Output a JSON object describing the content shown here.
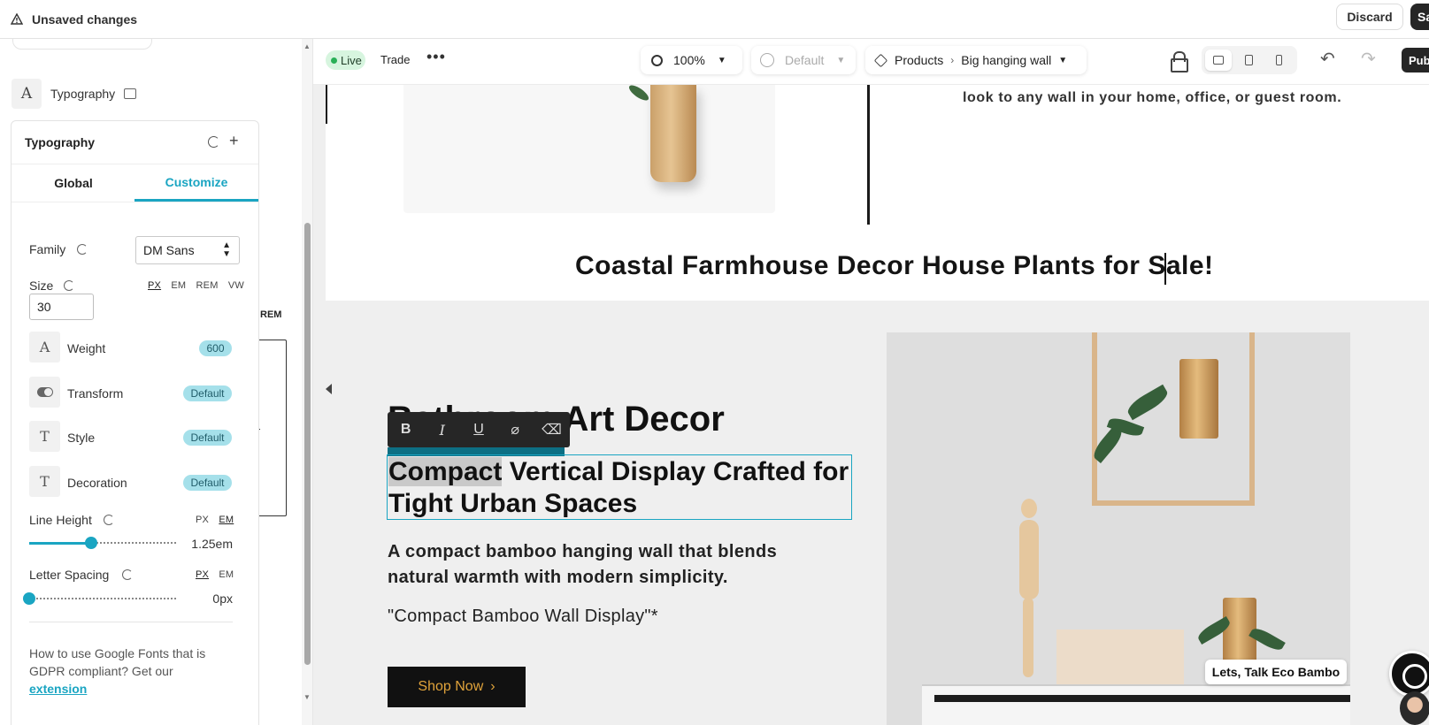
{
  "topbar": {
    "warning_icon": "alert-triangle-icon",
    "status_text": "Unsaved changes",
    "discard_label": "Discard",
    "save_label": "Sa"
  },
  "sidebar": {
    "section_icon": "letter-a-icon",
    "section_label": "Typography",
    "device_icon": "desktop-icon",
    "stray_unit": "REM",
    "panel": {
      "title": "Typography",
      "tabs": [
        {
          "label": "Global",
          "active": false
        },
        {
          "label": "Customize",
          "active": true
        }
      ],
      "family": {
        "label": "Family",
        "value": "DM Sans"
      },
      "size": {
        "label": "Size",
        "value": "30",
        "units": [
          "PX",
          "EM",
          "REM",
          "VW"
        ],
        "active_unit": "PX"
      },
      "weight": {
        "label": "Weight",
        "value": "600",
        "icon": "A"
      },
      "transform": {
        "label": "Transform",
        "value": "Default"
      },
      "style": {
        "label": "Style",
        "value": "Default",
        "icon": "T"
      },
      "decoration": {
        "label": "Decoration",
        "value": "Default",
        "icon": "T"
      },
      "line_height": {
        "label": "Line Height",
        "units": [
          "PX",
          "EM"
        ],
        "active_unit": "EM",
        "value": "1.25em",
        "slider_fraction": 0.42
      },
      "letter_spacing": {
        "label": "Letter Spacing",
        "units": [
          "PX",
          "EM"
        ],
        "active_unit": "PX",
        "value": "0px",
        "slider_fraction": 0.0
      },
      "help_text": "How to use Google Fonts that is GDPR compliant? Get our",
      "help_link": "extension"
    }
  },
  "canvas_toolbar": {
    "live_label": "Live",
    "trade_label": "Trade",
    "more_icon": "more-horizontal-icon",
    "zoom": "100%",
    "locale": "Default",
    "breadcrumb": [
      "Products",
      "Big hanging wall"
    ],
    "publish_label": "Pub"
  },
  "page": {
    "top_description": "look to any wall in your home, office, or guest room.",
    "headline": "Coastal Farmhouse Decor House Plants for Sale!",
    "section_heading": "Bathroom Art Decor",
    "editing_heading_selected": "Compact",
    "editing_heading_rest": " Vertical Display Crafted for Tight Urban Spaces",
    "paragraph": "A compact bamboo hanging wall that blends natural warmth with modern simplicity.",
    "quote": "\"Compact Bamboo Wall Display\"*",
    "cta_label": "Shop Now",
    "cta_arrow": "›",
    "chat_label": "Lets, Talk Eco Bambo"
  },
  "rte_toolbar": {
    "buttons": [
      "B",
      "I",
      "U",
      "link",
      "eraser"
    ]
  }
}
